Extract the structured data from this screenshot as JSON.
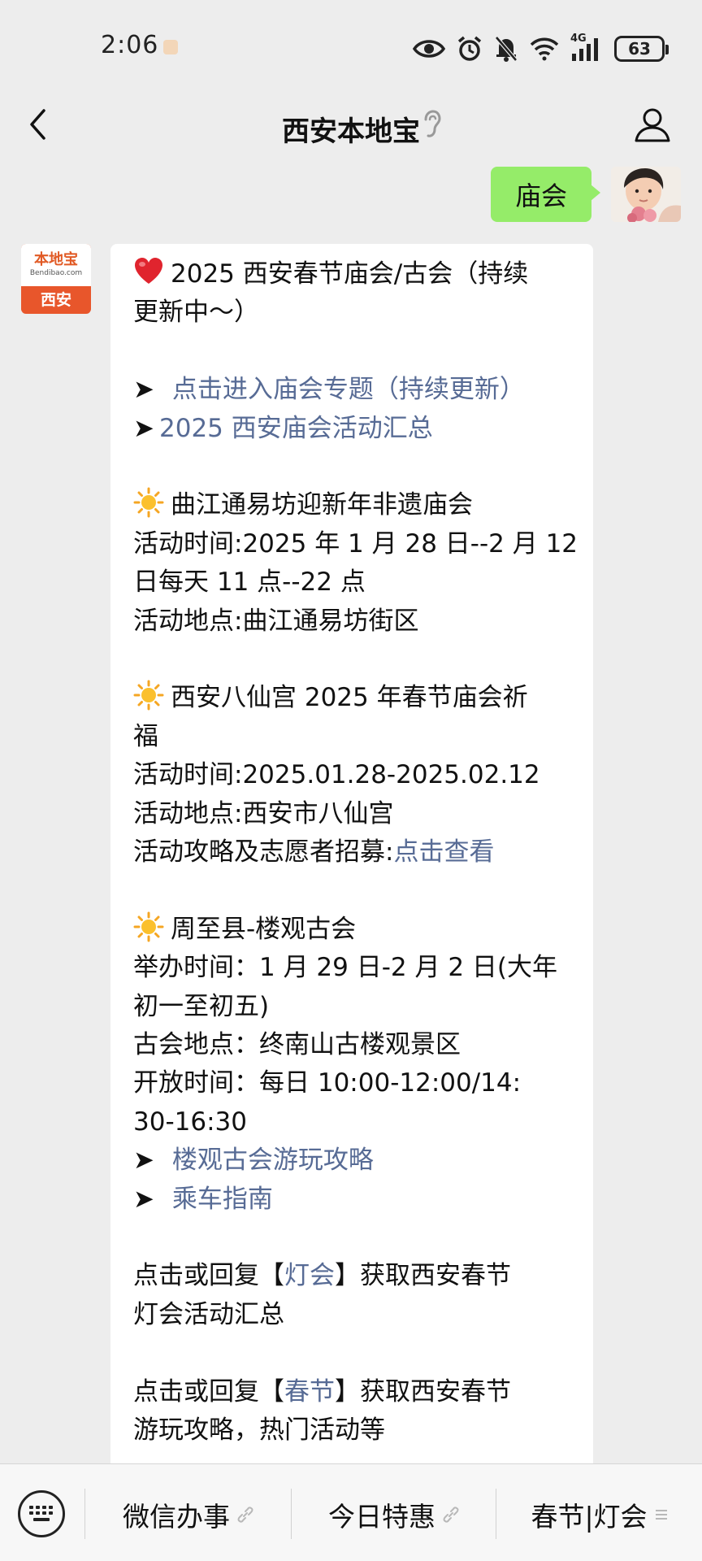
{
  "status": {
    "time": "2:06",
    "signal_label": "4G",
    "battery": "63"
  },
  "header": {
    "title": "西安本地宝"
  },
  "messages": {
    "sent": {
      "text": "庙会"
    },
    "bot": {
      "avatar_logo": "本地宝",
      "avatar_domain": "Bendibao.com",
      "avatar_city": "西安",
      "title_line1": "2025 西安春节庙会/古会（持续",
      "title_line2": "更新中～）",
      "arrow": "➤",
      "link_topic": " 点击进入庙会专题（持续更新）",
      "link_summary": "2025 西安庙会活动汇总",
      "e1_title": "曲江通易坊迎新年非遗庙会",
      "e1_time_1": "活动时间:2025 年 1 月 28 日--2 月 12",
      "e1_time_2": "日每天 11 点--22 点",
      "e1_place": "活动地点:曲江通易坊街区",
      "e2_title_1": "西安八仙宫 2025 年春节庙会祈",
      "e2_title_2": "福",
      "e2_time": "活动时间:2025.01.28-2025.02.12",
      "e2_place": "活动地点:西安市八仙宫",
      "e2_guide_label": "活动攻略及志愿者招募:",
      "e2_guide_link": "点击查看",
      "e3_title": "周至县-楼观古会",
      "e3_time_1": "举办时间：1 月 29 日-2 月 2 日(大年",
      "e3_time_2": "初一至初五)",
      "e3_place": "古会地点：终南山古楼观景区",
      "e3_open_1": "开放时间：每日 10:00-12:00/14:",
      "e3_open_2": "30-16:30",
      "e3_link_guide": " 楼观古会游玩攻略",
      "e3_link_bus": " 乘车指南",
      "reply1_pre": "点击或回复【",
      "reply1_kw": "灯会",
      "reply1_post": "】获取西安春节",
      "reply1_line2": "灯会活动汇总",
      "reply2_pre": "点击或回复【",
      "reply2_kw": "春节",
      "reply2_post": "】获取西安春节",
      "reply2_line2": "游玩攻略，热门活动等"
    }
  },
  "menu": {
    "item1": "微信办事",
    "item2": "今日特惠",
    "item3": "春节|灯会",
    "item1_icon": "link-icon",
    "item2_icon": "link-icon",
    "item3_icon": "list-icon"
  },
  "colors": {
    "sent_bubble": "#95ec69",
    "link": "#576b95",
    "background": "#ededed"
  }
}
